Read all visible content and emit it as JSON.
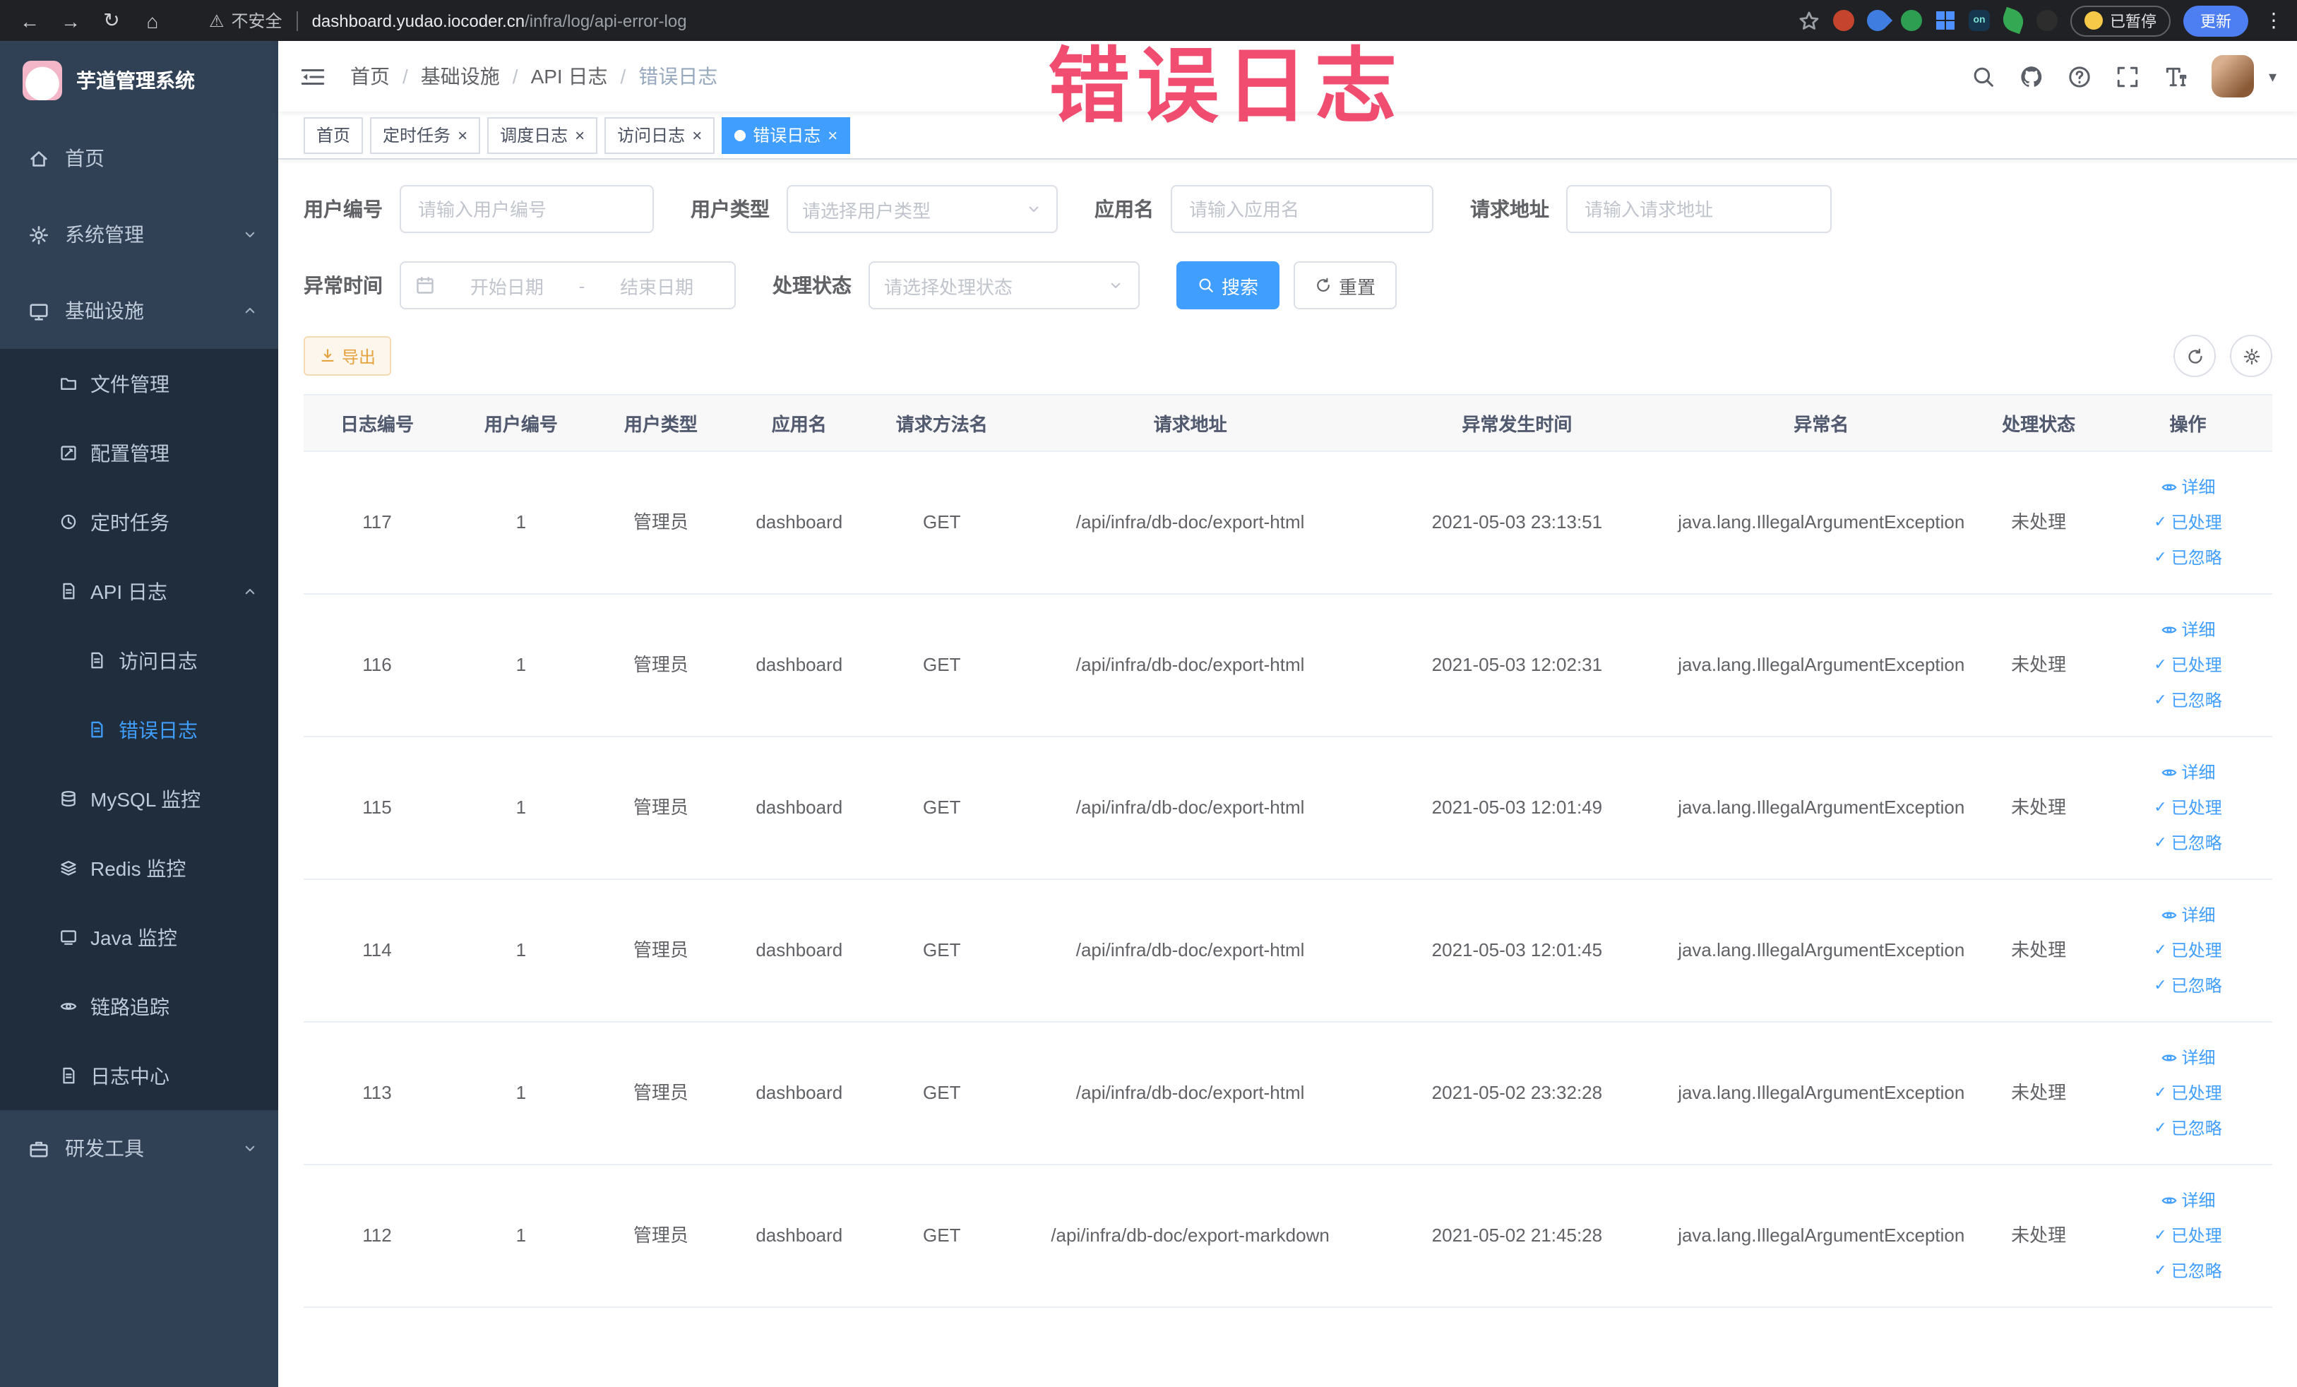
{
  "colors": {
    "accent_blue": "#409eff",
    "sidebar_bg": "#304156",
    "sidebar_submenu_bg": "#1f2d3d",
    "active_menu_text": "#409eff",
    "warning_orange": "#e6a23c",
    "annotation_red": "#ef4066",
    "chrome_bg": "#202124",
    "link_blue": "#409eff",
    "table_header_bg": "#f8f8f9"
  },
  "icons": {
    "back": "←",
    "forward": "→",
    "refresh": "↻",
    "home": "⌂",
    "warning": "⚠",
    "more_vertical": "⋮",
    "caret_down": "▾",
    "check": "✓",
    "close": "×",
    "ext_on_label": "on"
  },
  "browser": {
    "not_secure_label": "不安全",
    "url_host": "dashboard.yudao.iocoder.cn",
    "url_path": "/infra/log/api-error-log",
    "paused_badge": "已暂停",
    "update_button": "更新"
  },
  "annotation": {
    "text": "错误日志"
  },
  "sidebar": {
    "logo_title": "芋道管理系统",
    "items": {
      "home": "首页",
      "system": "系统管理",
      "infra": "基础设施",
      "file": "文件管理",
      "config": "配置管理",
      "job": "定时任务",
      "api_log": "API 日志",
      "access_log": "访问日志",
      "error_log": "错误日志",
      "mysql": "MySQL 监控",
      "redis": "Redis 监控",
      "java": "Java 监控",
      "trace": "链路追踪",
      "log_center": "日志中心",
      "dev_tools": "研发工具"
    }
  },
  "breadcrumb": {
    "separator": "/",
    "items": [
      "首页",
      "基础设施",
      "API 日志",
      "错误日志"
    ]
  },
  "tags": [
    {
      "label": "首页"
    },
    {
      "label": "定时任务"
    },
    {
      "label": "调度日志"
    },
    {
      "label": "访问日志"
    },
    {
      "label": "错误日志"
    }
  ],
  "filters": {
    "user_id_label": "用户编号",
    "user_id_placeholder": "请输入用户编号",
    "user_type_label": "用户类型",
    "user_type_placeholder": "请选择用户类型",
    "app_name_label": "应用名",
    "app_name_placeholder": "请输入应用名",
    "request_url_label": "请求地址",
    "request_url_placeholder": "请输入请求地址",
    "exception_time_label": "异常时间",
    "date_start_placeholder": "开始日期",
    "date_separator": "-",
    "date_end_placeholder": "结束日期",
    "process_status_label": "处理状态",
    "process_status_placeholder": "请选择处理状态",
    "search_button": "搜索",
    "reset_button": "重置"
  },
  "toolbar": {
    "export_button": "导出"
  },
  "table": {
    "columns": [
      "日志编号",
      "用户编号",
      "用户类型",
      "应用名",
      "请求方法名",
      "请求地址",
      "异常发生时间",
      "异常名",
      "处理状态",
      "操作"
    ],
    "actions": {
      "detail": "详细",
      "processed": "已处理",
      "ignored": "已忽略"
    },
    "rows": [
      {
        "id": "117",
        "user_id": "1",
        "user_type": "管理员",
        "app": "dashboard",
        "method": "GET",
        "url": "/api/infra/db-doc/export-html",
        "time": "2021-05-03 23:13:51",
        "exception": "java.lang.IllegalArgumentException",
        "status": "未处理"
      },
      {
        "id": "116",
        "user_id": "1",
        "user_type": "管理员",
        "app": "dashboard",
        "method": "GET",
        "url": "/api/infra/db-doc/export-html",
        "time": "2021-05-03 12:02:31",
        "exception": "java.lang.IllegalArgumentException",
        "status": "未处理"
      },
      {
        "id": "115",
        "user_id": "1",
        "user_type": "管理员",
        "app": "dashboard",
        "method": "GET",
        "url": "/api/infra/db-doc/export-html",
        "time": "2021-05-03 12:01:49",
        "exception": "java.lang.IllegalArgumentException",
        "status": "未处理"
      },
      {
        "id": "114",
        "user_id": "1",
        "user_type": "管理员",
        "app": "dashboard",
        "method": "GET",
        "url": "/api/infra/db-doc/export-html",
        "time": "2021-05-03 12:01:45",
        "exception": "java.lang.IllegalArgumentException",
        "status": "未处理"
      },
      {
        "id": "113",
        "user_id": "1",
        "user_type": "管理员",
        "app": "dashboard",
        "method": "GET",
        "url": "/api/infra/db-doc/export-html",
        "time": "2021-05-02 23:32:28",
        "exception": "java.lang.IllegalArgumentException",
        "status": "未处理"
      },
      {
        "id": "112",
        "user_id": "1",
        "user_type": "管理员",
        "app": "dashboard",
        "method": "GET",
        "url": "/api/infra/db-doc/export-markdown",
        "time": "2021-05-02 21:45:28",
        "exception": "java.lang.IllegalArgumentException",
        "status": "未处理"
      }
    ]
  }
}
